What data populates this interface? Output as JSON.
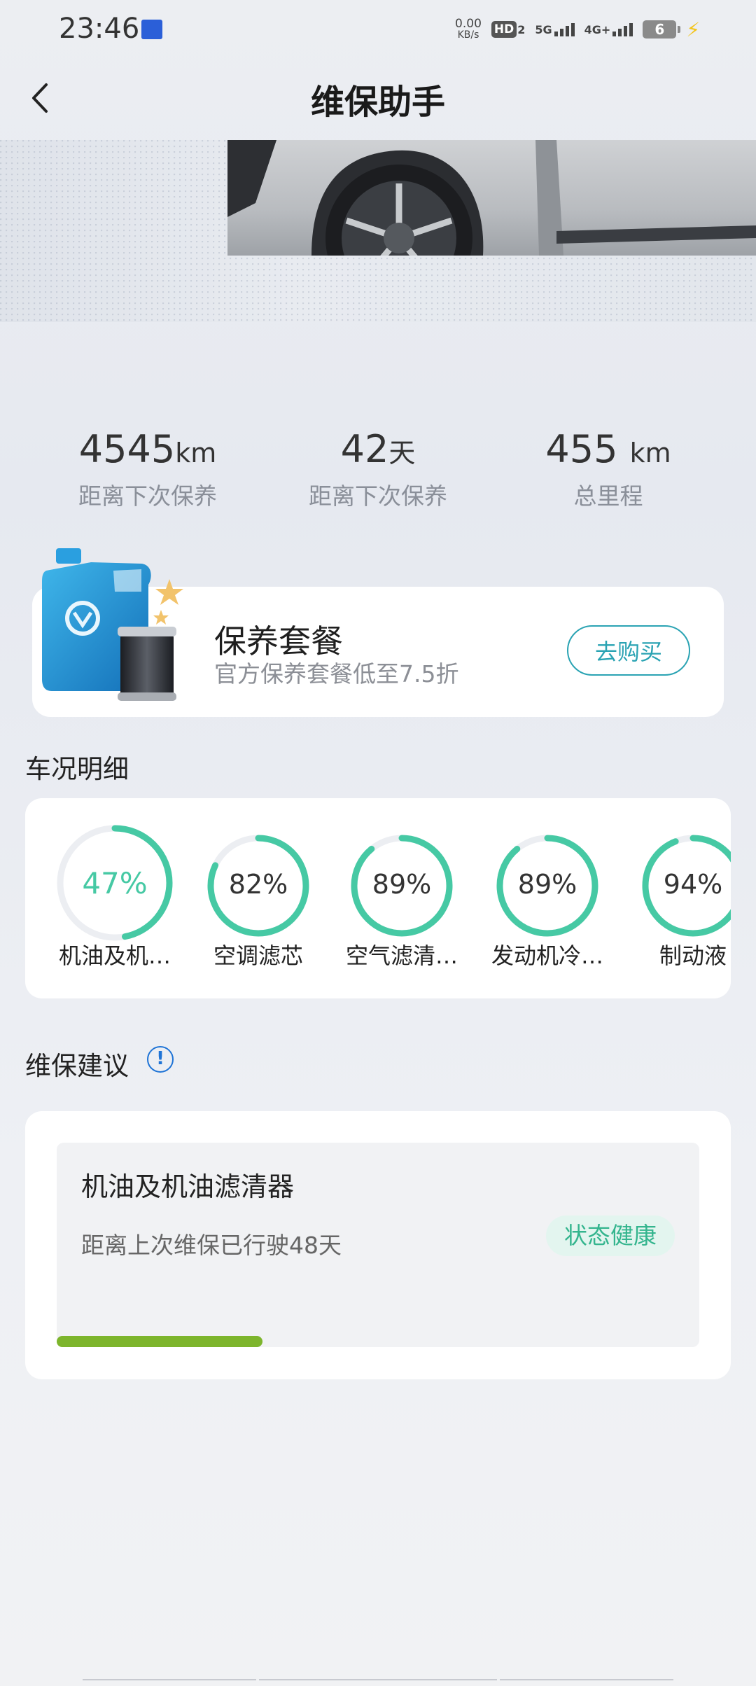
{
  "status_bar": {
    "time": "23:46",
    "net_speed_value": "0.00",
    "net_speed_unit": "KB/s",
    "hd_label": "HD",
    "hd_sub": "2",
    "net_5g": "5G",
    "net_4g": "4G+",
    "battery": "6"
  },
  "header": {
    "title": "维保助手"
  },
  "stats": [
    {
      "value": "4545",
      "unit": "km",
      "label": "距离下次保养"
    },
    {
      "value": "42",
      "unit": "天",
      "label": "距离下次保养"
    },
    {
      "value": "455 ",
      "unit": "km",
      "label": "总里程"
    }
  ],
  "package": {
    "title": "保养套餐",
    "subtitle": "官方保养套餐低至7.5折",
    "button": "去购买"
  },
  "condition": {
    "section_title": "车况明细",
    "items": [
      {
        "percent": 47,
        "percent_text": "47%",
        "label": "机油及机…",
        "color": "#46c9a4"
      },
      {
        "percent": 82,
        "percent_text": "82%",
        "label": "空调滤芯",
        "color": "#46c9a4"
      },
      {
        "percent": 89,
        "percent_text": "89%",
        "label": "空气滤清…",
        "color": "#46c9a4"
      },
      {
        "percent": 89,
        "percent_text": "89%",
        "label": "发动机冷…",
        "color": "#46c9a4"
      },
      {
        "percent": 94,
        "percent_text": "94%",
        "label": "制动液",
        "color": "#46c9a4"
      }
    ]
  },
  "advice": {
    "section_title": "维保建议",
    "item_title": "机油及机油滤清器",
    "item_desc": "距离上次维保已行驶48天",
    "badge": "状态健康",
    "progress": 0.32,
    "progress_color": "#7db52c"
  },
  "colors": {
    "accent": "#2aa3b3",
    "gauge_track": "#eceef2",
    "health": "#34b58e"
  }
}
